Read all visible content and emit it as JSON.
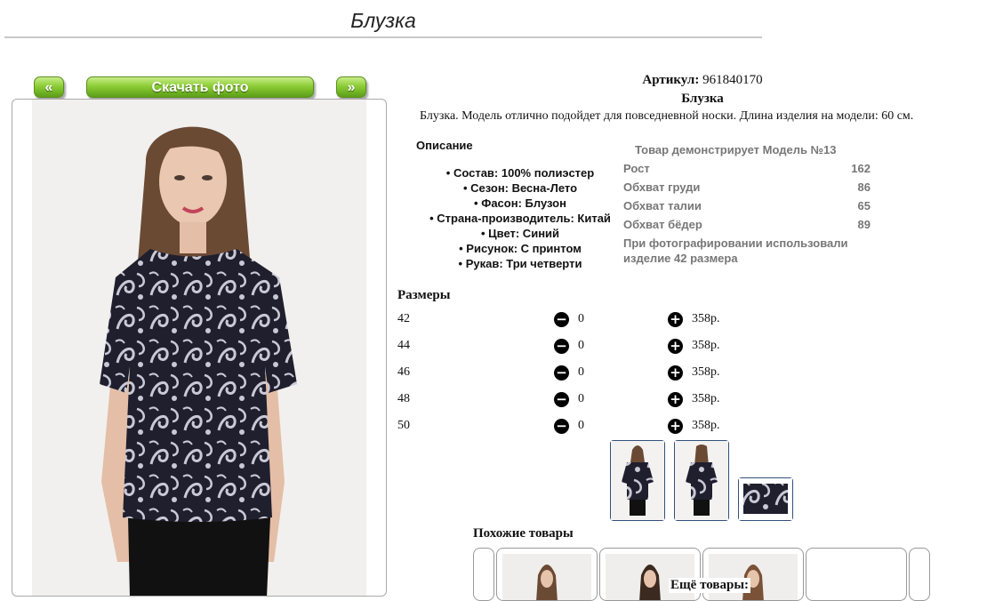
{
  "page": {
    "title": "Блузка"
  },
  "photo_controls": {
    "prev": "«",
    "download": "Скачать фото",
    "next": "»"
  },
  "product": {
    "article_label": "Артикул:",
    "article_value": "961840170",
    "name": "Блузка",
    "summary": "Блузка. Модель отлично подойдет для повседневной носки. Длина изделия на модели: 60 см."
  },
  "description": {
    "heading": "Описание",
    "items": [
      "Состав: 100% полиэстер",
      "Сезон: Весна-Лето",
      "Фасон: Блузон",
      "Страна-производитель: Китай",
      "Цвет: Синий",
      "Рисунок: С принтом",
      "Рукав: Три четверти"
    ]
  },
  "model_info": {
    "heading": "Товар демонстрирует Модель №13",
    "rows": [
      {
        "label": "Рост",
        "value": "162"
      },
      {
        "label": "Обхват груди",
        "value": "86"
      },
      {
        "label": "Обхват талии",
        "value": "65"
      },
      {
        "label": "Обхват бёдер",
        "value": "89"
      }
    ],
    "note_line1": "При фотографировании использовали",
    "note_line2": "изделие 42 размера"
  },
  "sizes": {
    "heading": "Размеры",
    "rows": [
      {
        "size": "42",
        "qty": "0",
        "price": "358р."
      },
      {
        "size": "44",
        "qty": "0",
        "price": "358р."
      },
      {
        "size": "46",
        "qty": "0",
        "price": "358р."
      },
      {
        "size": "48",
        "qty": "0",
        "price": "358р."
      },
      {
        "size": "50",
        "qty": "0",
        "price": "358р."
      }
    ]
  },
  "similar": {
    "heading": "Похожие товары"
  },
  "more": {
    "heading": "Ещё товары:"
  },
  "icons": {
    "minus": "minus-circle-icon",
    "plus": "plus-circle-icon"
  },
  "colors": {
    "button_green": "#8ccd35",
    "print_dark": "#1f1f2e",
    "thumb_border": "#33507a"
  }
}
